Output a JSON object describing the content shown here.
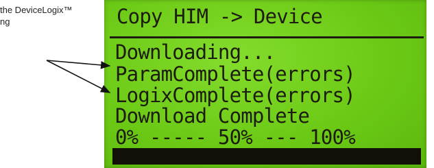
{
  "caption": {
    "line1": "the DeviceLogix™",
    "line2": "ng"
  },
  "lcd": {
    "title": "Copy HIM -> Device",
    "lines": [
      "Downloading...",
      "ParamComplete(errors)",
      "LogixComplete(errors)",
      "Download Complete"
    ],
    "scale": "0% ----- 50% --- 100%",
    "progress_fraction": 1.0
  }
}
